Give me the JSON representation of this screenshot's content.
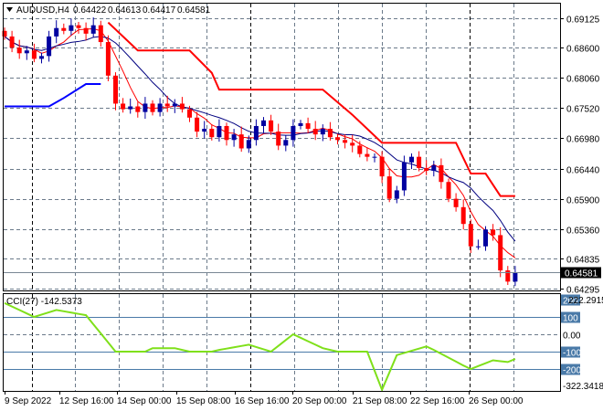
{
  "header": {
    "symbol": "AUDUSD,H4",
    "open": "0.64422",
    "high": "0.64613",
    "low": "0.64417",
    "close": "0.64581",
    "menu_icon": "triangle-down-icon"
  },
  "colors": {
    "bull": "#0000a0",
    "bear": "#ff0000",
    "ma_slow": "#000080",
    "ma_fast": "#ff0000",
    "stop_red": "#ff0000",
    "stop_blue": "#0000ff",
    "cci": "#7fe01a",
    "grid": "#6b7a8a"
  },
  "price_axis": {
    "labels": [
      "0.69125",
      "0.68600",
      "0.68060",
      "0.67520",
      "0.66980",
      "0.66440",
      "0.65900",
      "0.65360",
      "0.64835",
      "0.64295"
    ],
    "current": "0.64581"
  },
  "cci_panel": {
    "title": "CCI(27) -142.5373",
    "max_label": "222.2915",
    "min_label": "-322.3418",
    "levels": [
      "200",
      "100",
      "0.00",
      "-100",
      "-200"
    ]
  },
  "time_axis": {
    "labels": [
      "9 Sep 2022",
      "12 Sep 16:00",
      "14 Sep 00:00",
      "15 Sep 08:00",
      "16 Sep 16:00",
      "20 Sep 00:00",
      "21 Sep 08:00",
      "22 Sep 16:00",
      "26 Sep 00:00"
    ]
  },
  "chart_data": {
    "type": "candlestick",
    "ylim": [
      0.642,
      0.693
    ],
    "closes": [
      0.688,
      0.686,
      0.685,
      0.6855,
      0.684,
      0.6845,
      0.688,
      0.6895,
      0.689,
      0.69,
      0.6895,
      0.6885,
      0.69,
      0.687,
      0.681,
      0.676,
      0.675,
      0.6755,
      0.6745,
      0.676,
      0.6745,
      0.676,
      0.6755,
      0.676,
      0.675,
      0.6735,
      0.671,
      0.6715,
      0.67,
      0.672,
      0.6695,
      0.6705,
      0.668,
      0.6695,
      0.672,
      0.673,
      0.671,
      0.6685,
      0.6695,
      0.672,
      0.6725,
      0.6715,
      0.6705,
      0.6715,
      0.67,
      0.6695,
      0.669,
      0.6685,
      0.667,
      0.6665,
      0.6665,
      0.663,
      0.659,
      0.6605,
      0.6655,
      0.6665,
      0.6645,
      0.664,
      0.665,
      0.662,
      0.659,
      0.6575,
      0.6545,
      0.6505,
      0.6505,
      0.6535,
      0.6525,
      0.6462,
      0.6442,
      0.6458
    ],
    "first_open": 0.689,
    "stop_red_segments": [
      [
        14,
        0.6905
      ],
      [
        18,
        0.6855
      ],
      [
        25,
        0.6855
      ],
      [
        28,
        0.6815
      ],
      [
        29,
        0.6785
      ],
      [
        43,
        0.6785
      ],
      [
        47,
        0.674
      ],
      [
        51,
        0.669
      ],
      [
        61,
        0.669
      ],
      [
        63,
        0.6635
      ],
      [
        65,
        0.6635
      ],
      [
        67,
        0.6595
      ],
      [
        69,
        0.6595
      ]
    ],
    "stop_blue_segments": [
      [
        0,
        0.6755
      ],
      [
        6,
        0.6755
      ],
      [
        8,
        0.677
      ],
      [
        11,
        0.6795
      ],
      [
        13,
        0.6795
      ]
    ],
    "cci_keypoints": [
      [
        0,
        180
      ],
      [
        4,
        100
      ],
      [
        7,
        140
      ],
      [
        11,
        110
      ],
      [
        15,
        -100
      ],
      [
        19,
        -100
      ],
      [
        20,
        -80
      ],
      [
        23,
        -80
      ],
      [
        25,
        -100
      ],
      [
        28,
        -100
      ],
      [
        29,
        -90
      ],
      [
        33,
        -60
      ],
      [
        36,
        -100
      ],
      [
        39,
        0
      ],
      [
        43,
        -80
      ],
      [
        45,
        -100
      ],
      [
        49,
        -100
      ],
      [
        51,
        -320
      ],
      [
        53,
        -120
      ],
      [
        57,
        -70
      ],
      [
        58,
        -90
      ],
      [
        62,
        -180
      ],
      [
        63,
        -200
      ],
      [
        66,
        -150
      ],
      [
        68,
        -160
      ],
      [
        69,
        -142.5
      ]
    ],
    "cci_range": [
      -322.3418,
      222.2915
    ]
  }
}
